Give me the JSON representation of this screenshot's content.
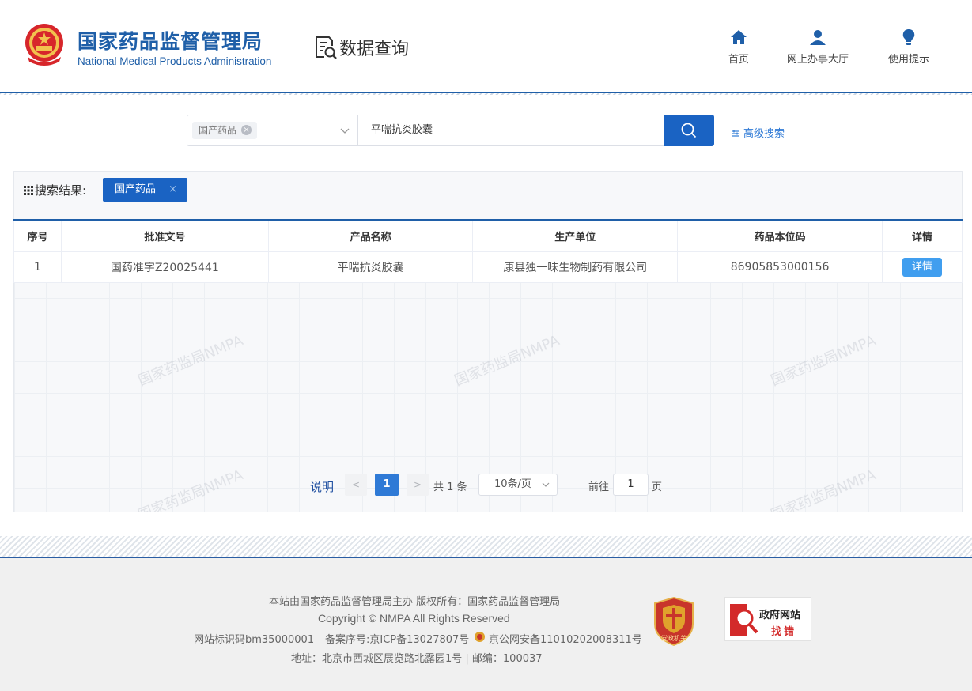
{
  "header": {
    "org_cn": "国家药品监督管理局",
    "org_en": "National Medical Products Administration",
    "section_title": "数据查询",
    "nav": [
      {
        "label": "首页",
        "icon": "home-icon"
      },
      {
        "label": "网上办事大厅",
        "icon": "user-icon"
      },
      {
        "label": "使用提示",
        "icon": "lightbulb-icon"
      }
    ]
  },
  "search": {
    "category_tag": "国产药品",
    "query": "平喘抗炎胶囊",
    "advanced_label": "高级搜索"
  },
  "results": {
    "label": "搜索结果:",
    "filter_tag": "国产药品",
    "watermark": "国家药监局NMPA",
    "columns": [
      "序号",
      "批准文号",
      "产品名称",
      "生产单位",
      "药品本位码",
      "详情"
    ],
    "rows": [
      {
        "index": "1",
        "approval_no": "国药准字Z20025441",
        "product_name": "平喘抗炎胶囊",
        "manufacturer": "康县独一味生物制药有限公司",
        "drug_code": "86905853000156",
        "detail_label": "详情"
      }
    ]
  },
  "pagination": {
    "desc_label": "说明",
    "prev": "<",
    "current_page": "1",
    "next": ">",
    "total_text": "共 1 条",
    "page_size": "10条/页",
    "goto_label": "前往",
    "goto_value": "1",
    "page_label": "页"
  },
  "footer": {
    "line1": "本站由国家药品监督管理局主办 版权所有：国家药品监督管理局",
    "line2": "Copyright © NMPA All Rights Reserved",
    "site_id": "网站标识码bm35000001",
    "icp": "备案序号:京ICP备13027807号",
    "police": "京公网安备11010202008311号",
    "address": "地址：北京市西城区展览路北露园1号 | 邮编：100037",
    "party_badge": "党政机关",
    "gov_error_line1": "政府网站",
    "gov_error_line2": "找错"
  },
  "colors": {
    "brand_blue": "#1f5fa8",
    "button_blue": "#1a63c3",
    "detail_blue": "#409eef"
  }
}
